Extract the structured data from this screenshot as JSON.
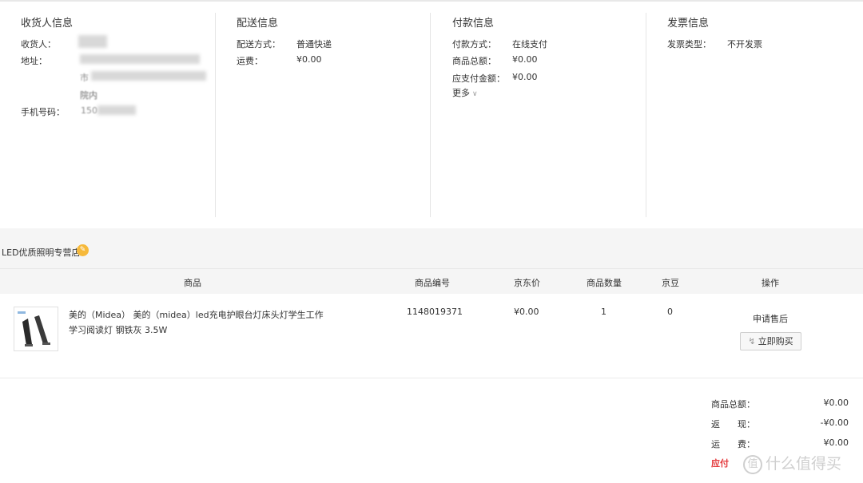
{
  "receiver": {
    "title": "收货人信息",
    "name_label": "收货人：",
    "address_label": "地址：",
    "address_line2_prefix": "市",
    "address_line3": "院内",
    "phone_label": "手机号码：",
    "phone_prefix": "150"
  },
  "delivery": {
    "title": "配送信息",
    "method_label": "配送方式：",
    "method_value": "普通快递",
    "fee_label": "运费：",
    "fee_value": "¥0.00"
  },
  "payment": {
    "title": "付款信息",
    "method_label": "付款方式：",
    "method_value": "在线支付",
    "total_label": "商品总额：",
    "total_value": "¥0.00",
    "due_label": "应支付金额：",
    "due_value": "¥0.00",
    "more_label": "更多"
  },
  "invoice": {
    "title": "发票信息",
    "type_label": "发票类型：",
    "type_value": "不开发票"
  },
  "store": {
    "name": "LED优质照明专营店"
  },
  "table": {
    "headers": [
      "商品",
      "商品编号",
      "京东价",
      "商品数量",
      "京豆",
      "操作"
    ]
  },
  "product": {
    "name": "美的（Midea） 美的（midea）led充电护眼台灯床头灯学生工作学习阅读灯 钢铁灰 3.5W",
    "sku": "1148019371",
    "price": "¥0.00",
    "quantity": "1",
    "beans": "0",
    "apply_after_sale": "申请售后",
    "buy_now": "立即购买"
  },
  "totals": {
    "goods_total_label": "商品总额：",
    "goods_total_value": "¥0.00",
    "rebate_label": "返　　现：",
    "rebate_value": "-¥0.00",
    "shipping_label": "运　　费：",
    "shipping_value": "¥0.00",
    "due_label": "应付"
  },
  "watermark": {
    "icon_char": "值",
    "text": "什么值得买"
  },
  "colors": {
    "accent_red": "#e4393c",
    "badge_orange": "#f6b93b",
    "band_gray": "#f5f5f5"
  }
}
